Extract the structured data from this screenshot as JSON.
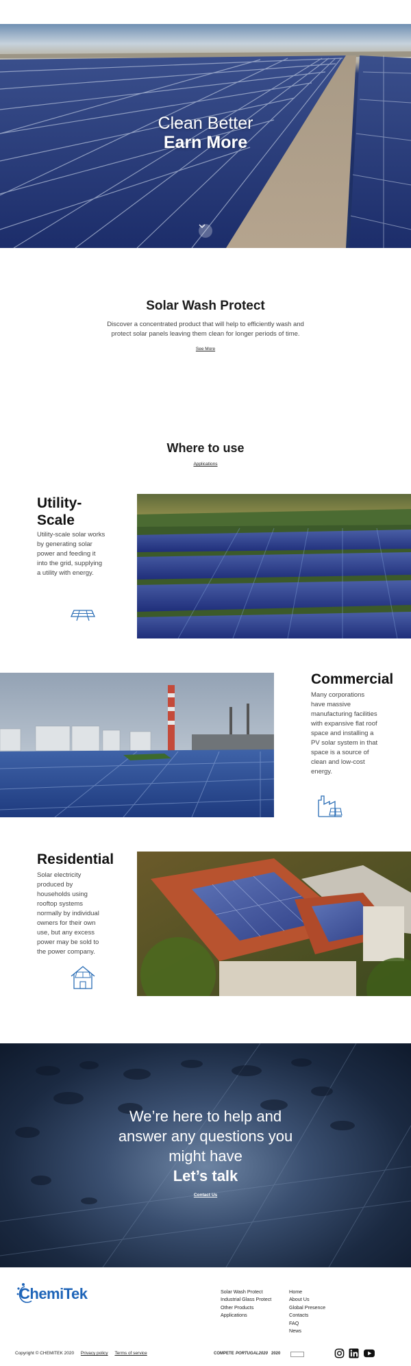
{
  "hero": {
    "line1": "Clean Better",
    "line2": "Earn More",
    "scroll_icon": "chevron-down-icon"
  },
  "solar_wash": {
    "title": "Solar Wash Protect",
    "description": "Discover a concentrated product that will help to efficiently wash and protect solar panels leaving them clean for longer periods of time.",
    "link": "See More"
  },
  "where_to_use": {
    "title": "Where to use",
    "link": "Applications"
  },
  "uses": [
    {
      "title_line1": "Utility-",
      "title_line2": "Scale",
      "text": "Utility-scale solar works by generating solar power and feeding it into the grid, supplying a utility with energy.",
      "icon": "solar-panel-icon"
    },
    {
      "title": "Commercial",
      "text": "Many corporations have massive manufacturing facilities with expansive flat roof space and installing a PV solar system in that space is a source of clean and low-cost energy.",
      "icon": "factory-icon"
    },
    {
      "title": "Residential",
      "text": "Solar electricity produced by households using rooftop systems normally by individual owners for their own use, but any excess power may be sold to the power company.",
      "icon": "house-icon"
    }
  ],
  "cta": {
    "line1": "We’re here to help and",
    "line2": "answer any questions you",
    "line3": "might have",
    "line4": "Let’s talk",
    "link": "Contact Us"
  },
  "footer": {
    "logo": "ChemiTek",
    "products": [
      "Solar Wash Protect",
      "Industrial Glass Protect",
      "Other Products",
      "Applications"
    ],
    "nav": [
      "Home",
      "About Us",
      "Global Presence",
      "Contacts",
      "FAQ",
      "News"
    ],
    "copyright": "Copyright © CHEMITEK 2020",
    "privacy": "Privacy policy",
    "terms": "Terms of service",
    "partners": [
      "COMPETE",
      "PORTUGAL2020",
      "2020"
    ],
    "social": [
      "instagram-icon",
      "linkedin-icon",
      "youtube-icon"
    ]
  },
  "colors": {
    "brand_blue": "#1e64b8",
    "icon_blue": "#2a6db5"
  }
}
